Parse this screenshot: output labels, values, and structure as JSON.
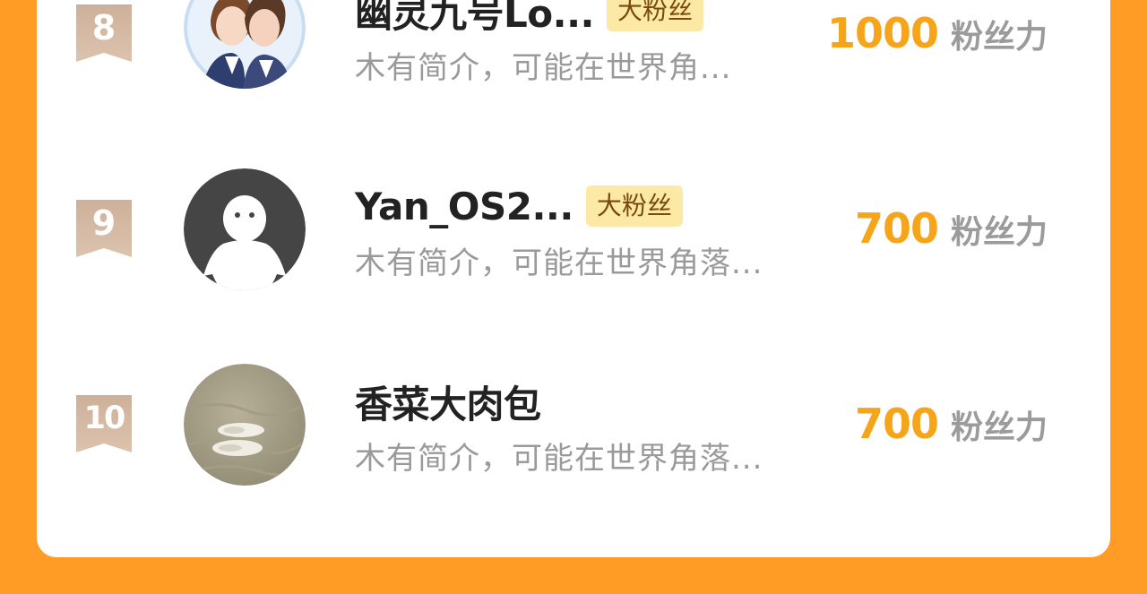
{
  "fan_list": {
    "entries": [
      {
        "rank": "8",
        "name": "幽灵九号Lo...",
        "tag": "大粉丝",
        "bio": "木有简介，可能在世界角...",
        "score": "1000",
        "score_unit": "粉丝力",
        "avatar": "anime-couple-avatar"
      },
      {
        "rank": "9",
        "name": "Yan_OS2...",
        "tag": "大粉丝",
        "bio": "木有简介，可能在世界角落...",
        "score": "700",
        "score_unit": "粉丝力",
        "avatar": "default-user-avatar"
      },
      {
        "rank": "10",
        "name": "香菜大肉包",
        "tag": "",
        "bio": "木有简介，可能在世界角落...",
        "score": "700",
        "score_unit": "粉丝力",
        "avatar": "shoes-on-sand-avatar"
      }
    ]
  },
  "colors": {
    "background": "#ff9c26",
    "card": "#ffffff",
    "rank_badge": "#d6b89e",
    "score": "#f6a51b",
    "tag_bg": "#fde9a6",
    "tag_text": "#7a4a0b"
  }
}
